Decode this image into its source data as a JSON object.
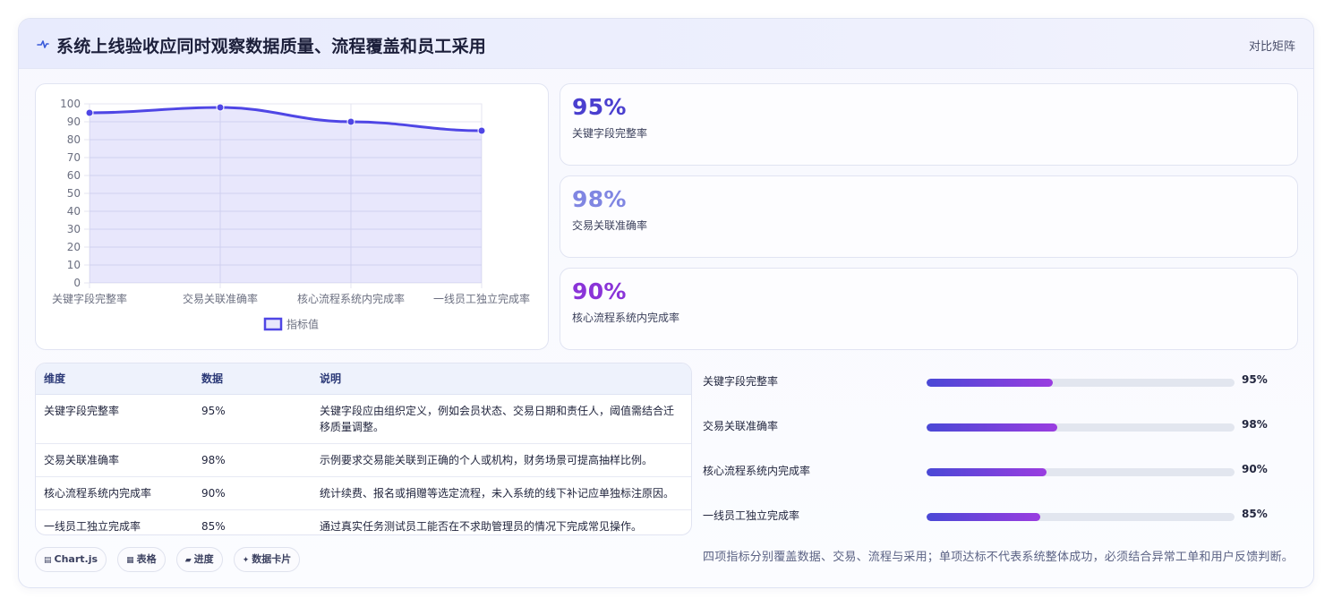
{
  "header": {
    "title": "系统上线验收应同时观察数据质量、流程覆盖和员工采用",
    "link_label": "对比矩阵",
    "icon": "pulse-icon"
  },
  "chart_data": {
    "type": "line",
    "categories": [
      "关键字段完整率",
      "交易关联准确率",
      "核心流程系统内完成率",
      "一线员工独立完成率"
    ],
    "series": [
      {
        "name": "指标值",
        "values": [
          95,
          98,
          90,
          85
        ],
        "color": "#4f46e5"
      }
    ],
    "ylim": [
      0,
      100
    ],
    "yticks": [
      0,
      10,
      20,
      30,
      40,
      50,
      60,
      70,
      80,
      90,
      100
    ],
    "fill": true,
    "legend": "bottom",
    "grid": true
  },
  "kpis": [
    {
      "value": "95%",
      "label": "关键字段完整率",
      "color": "#4a3fcf"
    },
    {
      "value": "98%",
      "label": "交易关联准确率",
      "color": "#8086e2"
    },
    {
      "value": "90%",
      "label": "核心流程系统内完成率",
      "color": "#8a34d8"
    }
  ],
  "table": {
    "headers": [
      "维度",
      "数据",
      "说明"
    ],
    "rows": [
      {
        "dim": "关键字段完整率",
        "value": "95%",
        "desc": "关键字段应由组织定义，例如会员状态、交易日期和责任人，阈值需结合迁移质量调整。"
      },
      {
        "dim": "交易关联准确率",
        "value": "98%",
        "desc": "示例要求交易能关联到正确的个人或机构，财务场景可提高抽样比例。"
      },
      {
        "dim": "核心流程系统内完成率",
        "value": "90%",
        "desc": "统计续费、报名或捐赠等选定流程，未入系统的线下补记应单独标注原因。"
      },
      {
        "dim": "一线员工独立完成率",
        "value": "85%",
        "desc": "通过真实任务测试员工能否在不求助管理员的情况下完成常见操作。"
      }
    ]
  },
  "bars": [
    {
      "label": "关键字段完整率",
      "value": "95%",
      "fraction": 0.41
    },
    {
      "label": "交易关联准确率",
      "value": "98%",
      "fraction": 0.425
    },
    {
      "label": "核心流程系统内完成率",
      "value": "90%",
      "fraction": 0.39
    },
    {
      "label": "一线员工独立完成率",
      "value": "85%",
      "fraction": 0.37
    }
  ],
  "note": "四项指标分别覆盖数据、交易、流程与采用；单项达标不代表系统整体成功，必须结合异常工单和用户反馈判断。",
  "chips": [
    {
      "icon": "chart-icon",
      "glyph": "▤",
      "label": "Chart.js"
    },
    {
      "icon": "table-icon",
      "glyph": "▦",
      "label": "表格"
    },
    {
      "icon": "progress-icon",
      "glyph": "▰",
      "label": "进度"
    },
    {
      "icon": "sparkle-icon",
      "glyph": "✦",
      "label": "数据卡片"
    }
  ]
}
